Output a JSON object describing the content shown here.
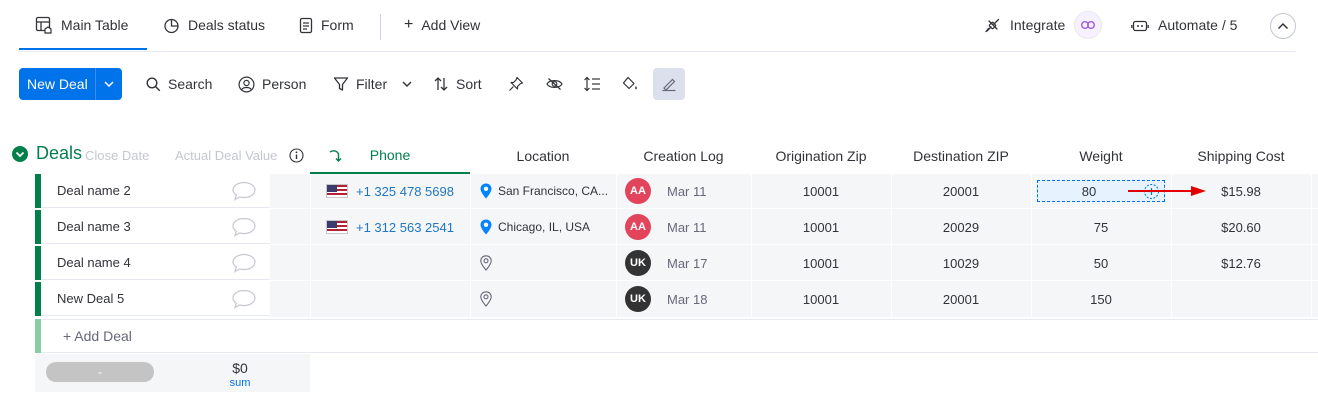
{
  "views": {
    "tabs": [
      {
        "label": "Main Table",
        "icon": "table-home-icon",
        "active": true
      },
      {
        "label": "Deals status",
        "icon": "pie-chart-icon"
      },
      {
        "label": "Form",
        "icon": "form-icon"
      }
    ],
    "add_view": "Add View",
    "integrate": "Integrate",
    "automate": "Automate / 5"
  },
  "toolbar": {
    "new_item": "New Deal",
    "search": "Search",
    "person": "Person",
    "filter": "Filter",
    "sort": "Sort"
  },
  "group": {
    "title": "Deals",
    "color": "#037f4c",
    "ghost_headers": [
      "Close Date",
      "Actual Deal Value"
    ]
  },
  "columns": [
    "Phone",
    "Location",
    "Creation Log",
    "Origination Zip",
    "Destination ZIP",
    "Weight",
    "Shipping Cost"
  ],
  "rows": [
    {
      "name": "Deal name 2",
      "phone": "+1 325 478 5698",
      "location": "San Francisco, CA...",
      "avatar": "AA",
      "avatar_color": "#e2445c",
      "date": "Mar 11",
      "orig_zip": "10001",
      "dest_zip": "20001",
      "weight": "80",
      "shipping": "$15.98"
    },
    {
      "name": "Deal name 3",
      "phone": "+1 312 563 2541",
      "location": "Chicago, IL, USA",
      "avatar": "AA",
      "avatar_color": "#e2445c",
      "date": "Mar 11",
      "orig_zip": "10001",
      "dest_zip": "20029",
      "weight": "75",
      "shipping": "$20.60"
    },
    {
      "name": "Deal name 4",
      "phone": "",
      "location": "",
      "avatar": "UK",
      "avatar_color": "#333333",
      "date": "Mar 17",
      "orig_zip": "10001",
      "dest_zip": "10029",
      "weight": "50",
      "shipping": "$12.76"
    },
    {
      "name": "New Deal 5",
      "phone": "",
      "location": "",
      "avatar": "UK",
      "avatar_color": "#333333",
      "date": "Mar 18",
      "orig_zip": "10001",
      "dest_zip": "20001",
      "weight": "150",
      "shipping": ""
    }
  ],
  "add_item": "+ Add Deal",
  "summary": {
    "pill": "-",
    "value": "$0",
    "label": "sum"
  }
}
